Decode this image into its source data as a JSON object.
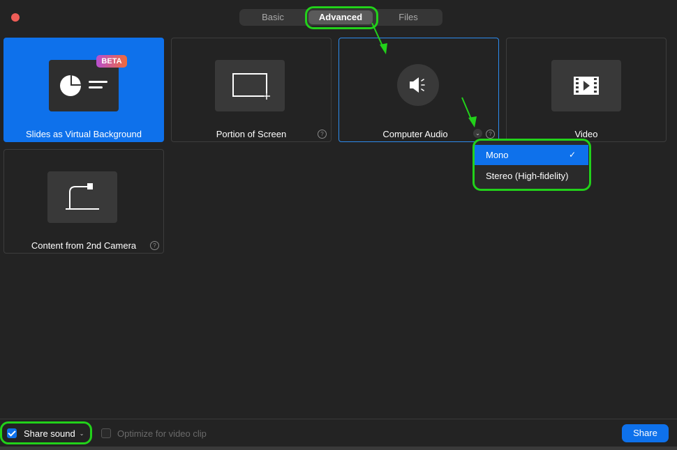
{
  "tabs": [
    {
      "label": "Basic"
    },
    {
      "label": "Advanced"
    },
    {
      "label": "Files"
    }
  ],
  "cards": {
    "slides": {
      "label": "Slides as Virtual Background",
      "badge": "BETA"
    },
    "portion": {
      "label": "Portion of Screen"
    },
    "audio": {
      "label": "Computer Audio"
    },
    "video": {
      "label": "Video"
    },
    "camera": {
      "label": "Content from 2nd Camera"
    }
  },
  "help_glyph": "?",
  "chevron_glyph": "⌄",
  "audio_dropdown": {
    "options": [
      {
        "label": "Mono",
        "selected": true
      },
      {
        "label": "Stereo (High-fidelity)",
        "selected": false
      }
    ],
    "check_glyph": "✓"
  },
  "footer": {
    "share_sound": {
      "label": "Share sound",
      "checked": true
    },
    "optimize": {
      "label": "Optimize for video clip",
      "checked": false
    },
    "share_button": "Share"
  },
  "colors": {
    "accent": "#0e71eb",
    "highlight": "#22d11a",
    "background": "#232323"
  },
  "icons": [
    "pie-chart-icon",
    "crop-region-icon",
    "speaker-icon",
    "film-icon",
    "document-camera-icon"
  ]
}
